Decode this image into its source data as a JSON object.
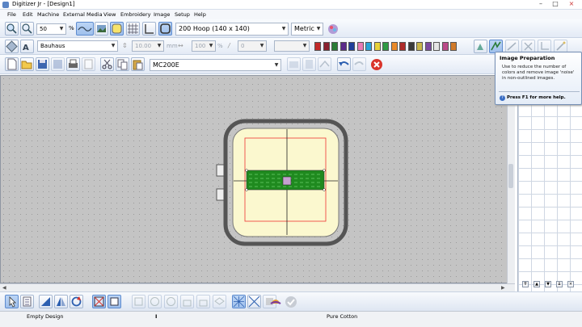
{
  "window": {
    "title": "Digitizer Jr - [Design1]",
    "minimize": "–",
    "maximize": "□",
    "close": "×"
  },
  "menu": [
    "File",
    "Edit",
    "Machine",
    "External Media",
    "View",
    "Embroidery",
    "Image",
    "Setup",
    "Help"
  ],
  "toolbar1": {
    "zoom_value": "50",
    "zoom_unit": "%",
    "hoop": "200 Hoop (140 x 140)",
    "units": "Metric",
    "icons": [
      "zoom-in-icon",
      "zoom-out-icon",
      "show-stitches-icon",
      "show-image-icon",
      "show-hoop-icon",
      "show-grid-icon",
      "hoop-icon",
      "color-palette-icon"
    ]
  },
  "toolbar2": {
    "font": "Bauhaus",
    "height_value": "10.00",
    "height_unit": "mm",
    "width_value": "100",
    "width_unit": "%",
    "slant_value": "0",
    "swatches": [
      "#c22a2a",
      "#8a2230",
      "#2a7c36",
      "#5b2b8a",
      "#1f3f9a",
      "#e87ab5",
      "#2aa4d8",
      "#e7d23a",
      "#2f9a44",
      "#e98a2a",
      "#ae2b2b",
      "#3a3a3a",
      "#c9b64a",
      "#7d4aa0",
      "#e6e6e6",
      "#bb4a8a",
      "#d07a2a"
    ]
  },
  "toolbar3": {
    "machine": "MC200E"
  },
  "tooltip": {
    "heading": "Image Preparation",
    "body": "Use to reduce the number of colors and remove image 'noise' in non-outlined images.",
    "help": "Press F1 for more help."
  },
  "status": {
    "design": "Empty Design",
    "fabric": "Pure Cotton"
  }
}
